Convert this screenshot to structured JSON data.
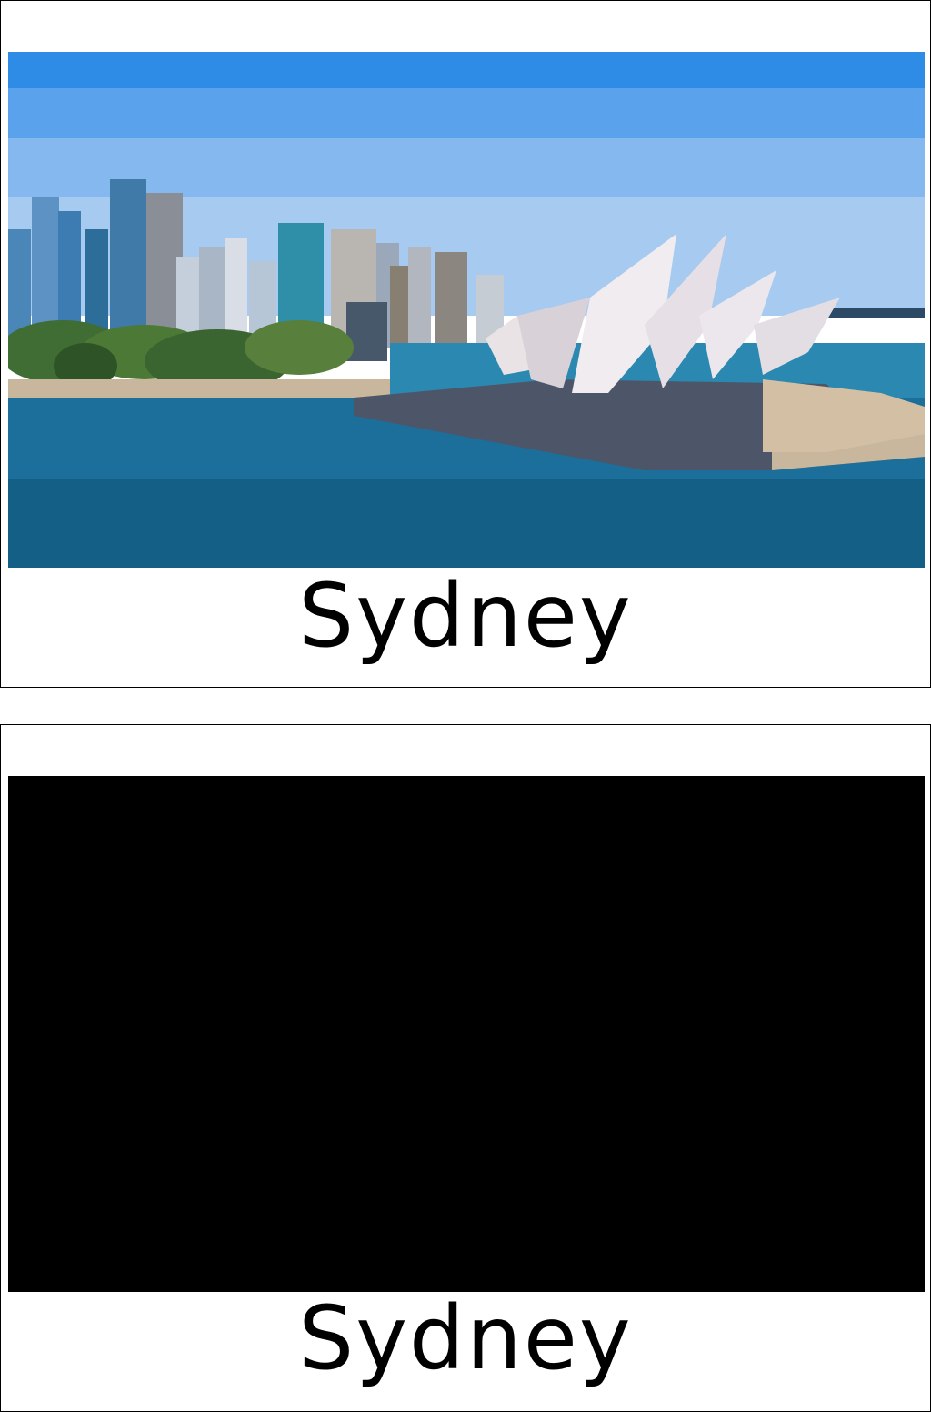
{
  "cards": [
    {
      "caption": "Sydney",
      "image": "sydney-opera-house-harbour-photo"
    },
    {
      "caption": "Sydney",
      "image": "black-placeholder"
    }
  ],
  "colors": {
    "sky": "#3f8fe3",
    "water": "#1c6f9a",
    "opera_house": "#e9e3e6",
    "placeholder": "#000000"
  }
}
